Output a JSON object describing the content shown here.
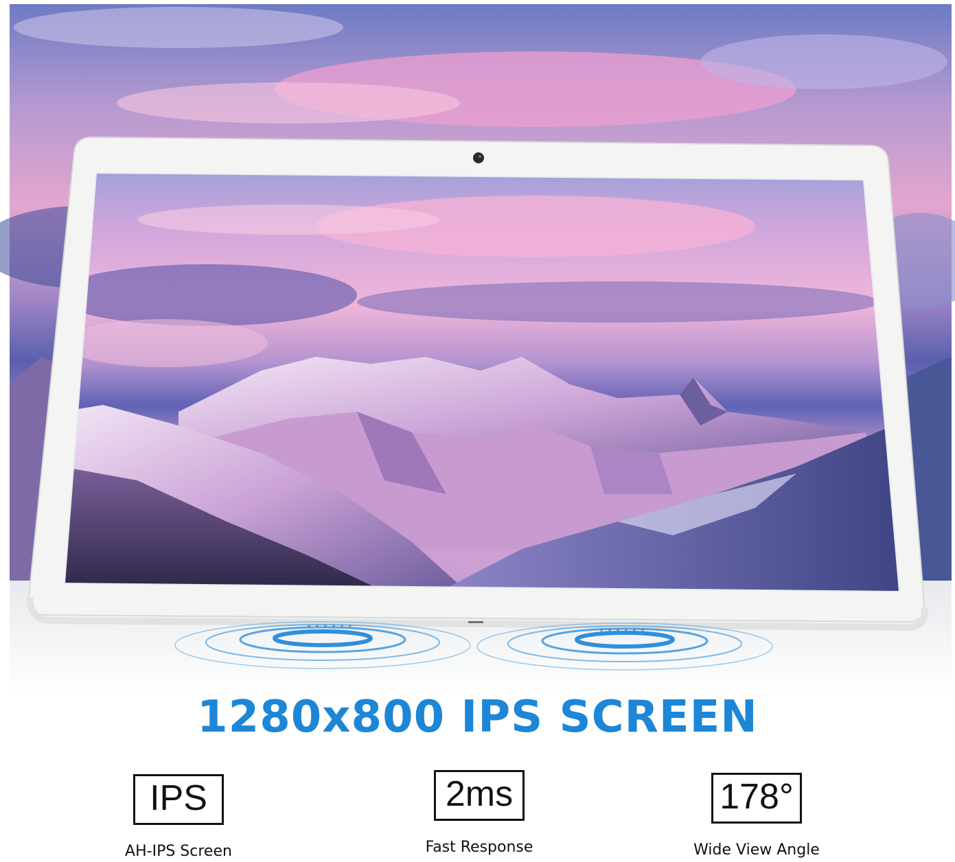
{
  "headline": "1280x800 IPS SCREEN",
  "features": [
    {
      "badge": "IPS",
      "label": "AH-IPS Screen"
    },
    {
      "badge": "2ms",
      "label": "Fast Response"
    },
    {
      "badge": "178°",
      "label": "Wide View Angle"
    }
  ],
  "colors": {
    "headline": "#1d86d6",
    "sky_top": "#6a6fb8",
    "sky_pink": "#e9a4c9",
    "tablet_frame": "#f4f5f3",
    "speaker_waves": "#2f8fdc"
  },
  "icons": [
    "camera-icon",
    "speaker-wave-icon"
  ]
}
